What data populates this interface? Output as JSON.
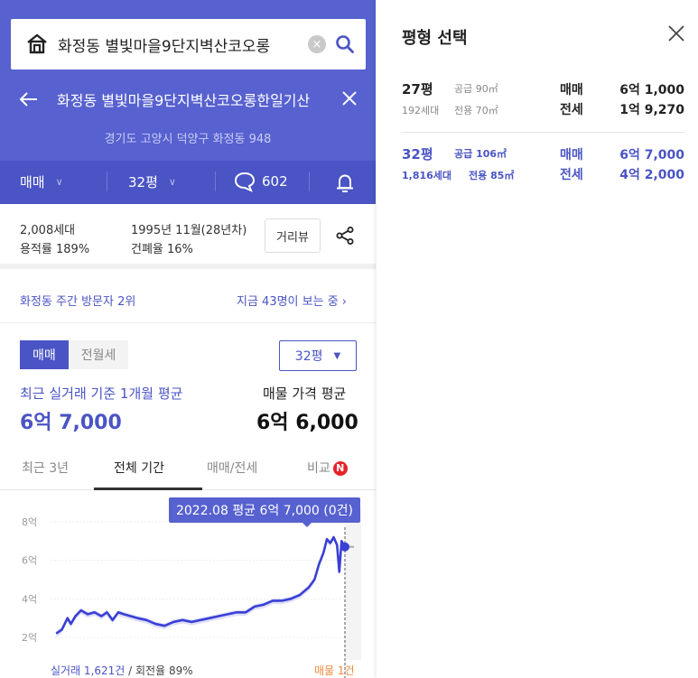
{
  "search": {
    "query": "화정동 별빛마을9단지벽산코오롱"
  },
  "header": {
    "title": "화정동 별빛마을9단지벽산코오롱한일기산",
    "address": "경기도 고양시 덕양구 화정동 948"
  },
  "options": {
    "trade_type": "매매",
    "size": "32평",
    "comments": "602"
  },
  "info": {
    "households": "2,008세대",
    "floor_area_ratio": "용적률 189%",
    "built": "1995년 11월(28년차)",
    "coverage_ratio": "건폐율 16%",
    "street_view": "거리뷰"
  },
  "visit": {
    "rank": "화정동 주간 방문자 2위",
    "viewing_now": "지금 43명이 보는 중 ›"
  },
  "trade_tabs": {
    "sale": "매매",
    "rent": "전월세"
  },
  "size_select": {
    "value": "32평"
  },
  "summary": {
    "recent_label": "최근 실거래 기준 1개월 평균",
    "recent_price": "6억 7,000",
    "listing_label": "매물 가격 평균",
    "listing_price": "6억 6,000"
  },
  "period_tabs": {
    "recent3": "최근 3년",
    "all": "전체 기간",
    "sale_rent": "매매/전세",
    "compare": "비교",
    "badge": "N"
  },
  "chart": {
    "tooltip": "2022.08 평균 6억 7,000 (0건)",
    "footer_trades_label": "실거래 1,621건",
    "footer_turnover": " / 회전율 89%",
    "footer_listings": "매물 1건"
  },
  "chart_data": {
    "type": "line",
    "y_tick_labels": [
      "8억",
      "6억",
      "4억",
      "2억"
    ],
    "ylim": [
      2,
      8
    ],
    "x_range": [
      "1995",
      "2022.08"
    ],
    "series": [
      {
        "values": [
          [
            1997.0,
            2.2
          ],
          [
            1997.5,
            2.4
          ],
          [
            1998.0,
            3.0
          ],
          [
            1998.3,
            2.7
          ],
          [
            1998.7,
            3.1
          ],
          [
            1999.2,
            3.4
          ],
          [
            1999.8,
            3.2
          ],
          [
            2000.4,
            3.3
          ],
          [
            2001.0,
            3.1
          ],
          [
            2001.5,
            3.3
          ],
          [
            2002.0,
            2.9
          ],
          [
            2002.5,
            3.3
          ],
          [
            2003.0,
            3.2
          ],
          [
            2003.6,
            3.1
          ],
          [
            2004.2,
            3.0
          ],
          [
            2005.0,
            2.9
          ],
          [
            2005.8,
            2.7
          ],
          [
            2006.6,
            2.6
          ],
          [
            2007.4,
            2.8
          ],
          [
            2008.2,
            2.9
          ],
          [
            2009.0,
            2.8
          ],
          [
            2009.8,
            2.9
          ],
          [
            2010.6,
            3.0
          ],
          [
            2011.4,
            3.1
          ],
          [
            2012.2,
            3.2
          ],
          [
            2013.0,
            3.3
          ],
          [
            2013.8,
            3.3
          ],
          [
            2014.6,
            3.6
          ],
          [
            2015.4,
            3.7
          ],
          [
            2016.2,
            3.9
          ],
          [
            2017.0,
            3.9
          ],
          [
            2017.8,
            4.0
          ],
          [
            2018.6,
            4.2
          ],
          [
            2019.4,
            4.6
          ],
          [
            2019.9,
            5.0
          ],
          [
            2020.3,
            5.8
          ],
          [
            2020.7,
            6.4
          ],
          [
            2021.0,
            7.1
          ],
          [
            2021.3,
            6.9
          ],
          [
            2021.6,
            7.2
          ],
          [
            2021.9,
            6.8
          ],
          [
            2022.1,
            5.4
          ],
          [
            2022.3,
            7.0
          ],
          [
            2022.6,
            6.7
          ]
        ]
      }
    ],
    "listing_line": 6.7,
    "point_highlight": [
      2022.6,
      6.7
    ]
  }
}
